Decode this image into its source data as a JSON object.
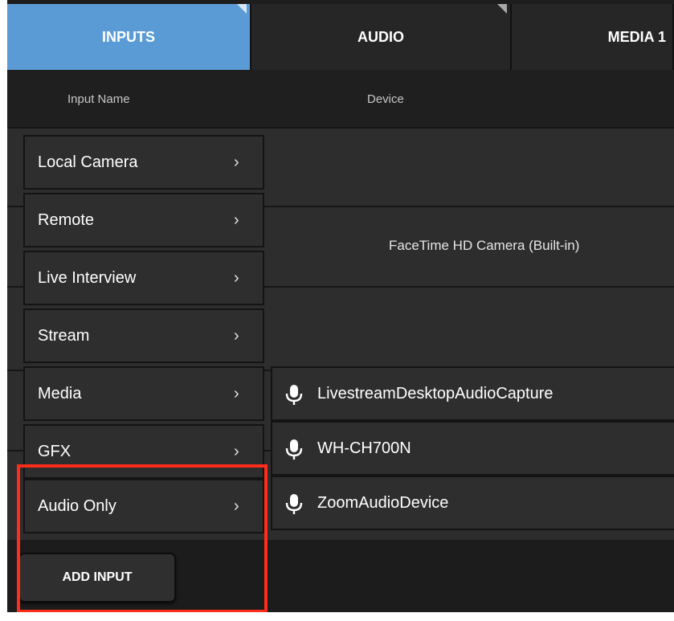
{
  "tabs": [
    {
      "label": "INPUTS",
      "active": true
    },
    {
      "label": "AUDIO",
      "active": false
    },
    {
      "label": "MEDIA 1",
      "active": false
    }
  ],
  "columns": {
    "input_name": "Input Name",
    "device": "Device"
  },
  "background_rows": [
    {
      "device": ""
    },
    {
      "device": "FaceTime HD Camera (Built-in)"
    },
    {
      "device": ""
    },
    {
      "device": ""
    }
  ],
  "menu": {
    "items": [
      {
        "label": "Local Camera",
        "icon": "chevron-right-icon"
      },
      {
        "label": "Remote",
        "icon": "chevron-right-icon"
      },
      {
        "label": "Live Interview",
        "icon": "chevron-right-icon"
      },
      {
        "label": "Stream",
        "icon": "chevron-right-icon"
      },
      {
        "label": "Media",
        "icon": "chevron-right-icon"
      },
      {
        "label": "GFX",
        "icon": "chevron-right-icon"
      },
      {
        "label": "Audio Only",
        "icon": "chevron-right-icon"
      }
    ],
    "chevron": "›"
  },
  "submenu": {
    "items": [
      {
        "label": "LivestreamDesktopAudioCapture",
        "icon": "microphone-icon"
      },
      {
        "label": "WH-CH700N",
        "icon": "microphone-icon"
      },
      {
        "label": "ZoomAudioDevice",
        "icon": "microphone-icon"
      }
    ]
  },
  "add_input_label": "ADD INPUT",
  "colors": {
    "active_tab": "#5b9bd5",
    "highlight": "#ff2d1a",
    "panel": "#2e2e2e"
  }
}
